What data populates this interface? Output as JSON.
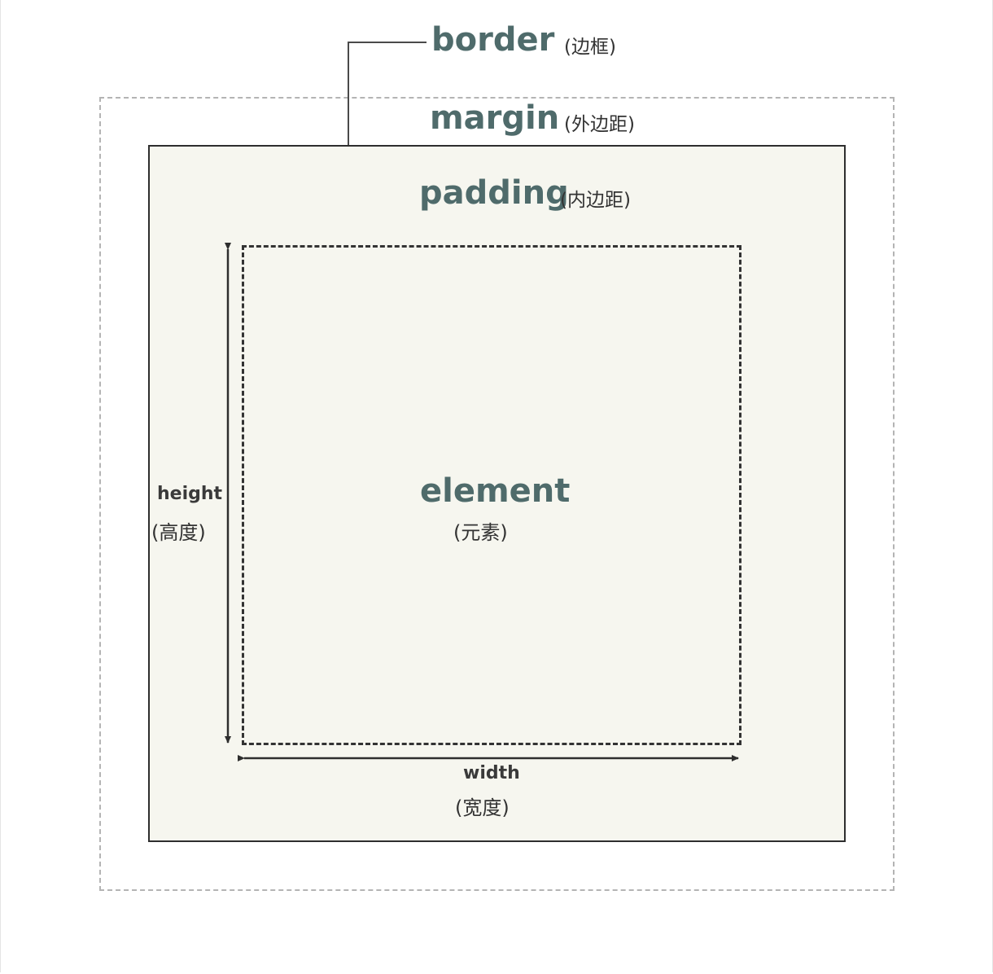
{
  "labels": {
    "border": {
      "term": "border",
      "cn": "(边框)"
    },
    "margin": {
      "term": "margin",
      "cn": "(外边距)"
    },
    "padding": {
      "term": "padding",
      "cn": "(内边距)"
    },
    "element": {
      "term": "element",
      "cn": "(元素)"
    },
    "height": {
      "term": "height",
      "cn": "(高度)"
    },
    "width": {
      "term": "width",
      "cn": "(宽度)"
    }
  },
  "colors": {
    "term_text": "#4f6b6b",
    "border_fill": "#f6f6ef",
    "border_line": "#2e2e2e",
    "margin_dash": "#b4b4b4",
    "element_dash": "#333333"
  }
}
